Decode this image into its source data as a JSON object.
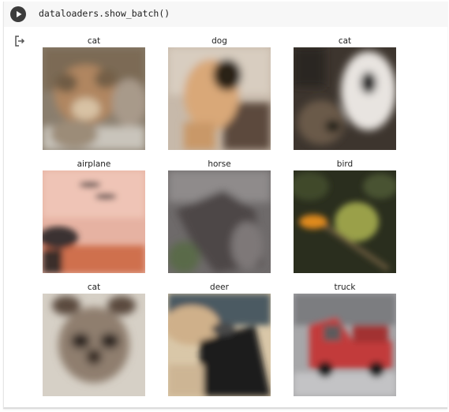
{
  "cell": {
    "code": "dataloaders.show_batch()"
  },
  "icons": {
    "run": "play-icon",
    "output": "output-redirect-icon"
  },
  "batch": [
    {
      "label": "cat"
    },
    {
      "label": "dog"
    },
    {
      "label": "cat"
    },
    {
      "label": "airplane"
    },
    {
      "label": "horse"
    },
    {
      "label": "bird"
    },
    {
      "label": "cat"
    },
    {
      "label": "deer"
    },
    {
      "label": "truck"
    }
  ]
}
